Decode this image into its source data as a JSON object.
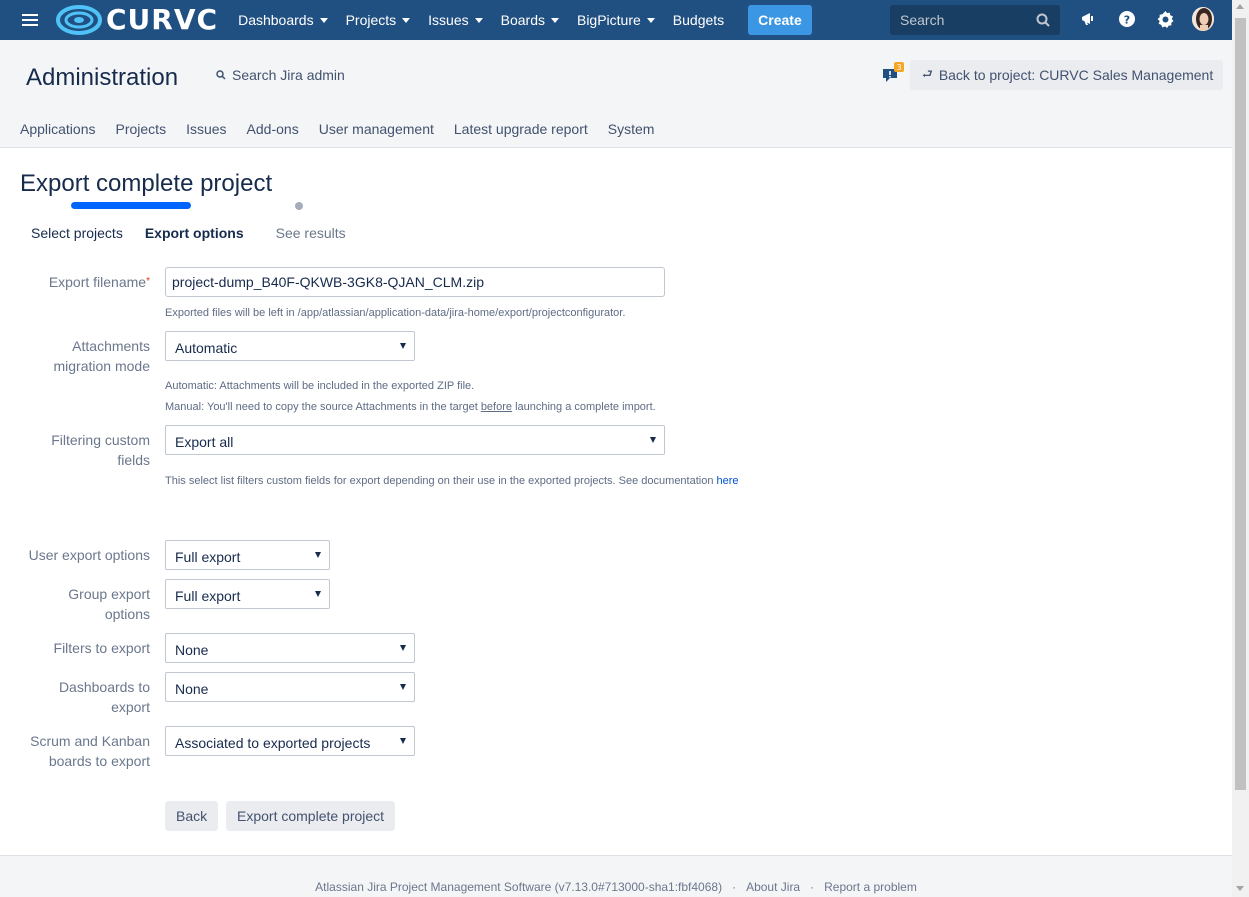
{
  "topnav": {
    "logo_text": "CURVC",
    "items": [
      {
        "label": "Dashboards",
        "dropdown": true
      },
      {
        "label": "Projects",
        "dropdown": true
      },
      {
        "label": "Issues",
        "dropdown": true
      },
      {
        "label": "Boards",
        "dropdown": true
      },
      {
        "label": "BigPicture",
        "dropdown": true
      },
      {
        "label": "Budgets",
        "dropdown": false
      }
    ],
    "create_label": "Create",
    "search_placeholder": "Search",
    "colors": {
      "bar": "#205081",
      "create": "#3b97e3"
    }
  },
  "admin": {
    "title": "Administration",
    "search_label": "Search Jira admin",
    "feedback_count": "3",
    "back_button": "Back to project: CURVC Sales Management",
    "tabs": [
      "Applications",
      "Projects",
      "Issues",
      "Add-ons",
      "User management",
      "Latest upgrade report",
      "System"
    ]
  },
  "main": {
    "title": "Export complete project",
    "steps": {
      "select": "Select projects",
      "options": "Export options",
      "results": "See results"
    },
    "fields": {
      "filename": {
        "label": "Export filename",
        "required": "*",
        "value": "project-dump_B40F-QKWB-3GK8-QJAN_CLM.zip",
        "help": "Exported files will be left in /app/atlassian/application-data/jira-home/export/projectconfigurator."
      },
      "attachments": {
        "label_1": "Attachments",
        "label_2": "migration mode",
        "value": "Automatic",
        "help_1": "Automatic: Attachments will be included in the exported ZIP file.",
        "help_2_a": "Manual: You'll need to copy the source Attachments in the target ",
        "help_2_u": "before",
        "help_2_b": " launching a complete import."
      },
      "custom_fields": {
        "label_1": "Filtering custom",
        "label_2": "fields",
        "value": "Export all",
        "help": "This select list filters custom fields for export depending on their use in the exported projects. See documentation ",
        "help_link": "here"
      },
      "user_export": {
        "label": "User export options",
        "value": "Full export"
      },
      "group_export": {
        "label_1": "Group export",
        "label_2": "options",
        "value": "Full export"
      },
      "filters": {
        "label": "Filters to export",
        "value": "None"
      },
      "dashboards": {
        "label_1": "Dashboards to",
        "label_2": "export",
        "value": "None"
      },
      "boards": {
        "label_1": "Scrum and Kanban",
        "label_2": "boards to export",
        "value": "Associated to exported projects"
      }
    },
    "buttons": {
      "back": "Back",
      "export": "Export complete project"
    }
  },
  "footer": {
    "software": "Atlassian Jira Project Management Software (v7.13.0#713000-sha1:fbf4068)",
    "sep": "·",
    "about": "About Jira",
    "report": "Report a problem"
  }
}
